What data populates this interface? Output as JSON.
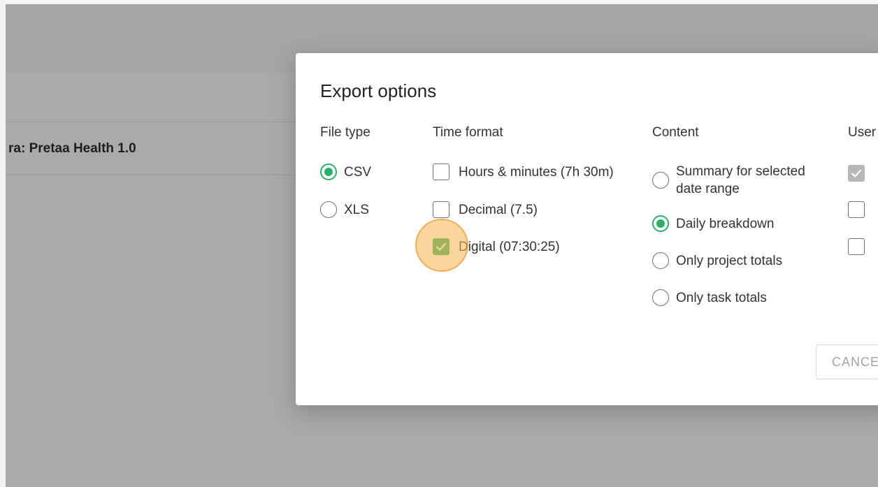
{
  "background": {
    "project_title": "ra: Pretaa Health 1.0"
  },
  "dialog": {
    "title": "Export options",
    "file_type": {
      "heading": "File type",
      "options": [
        {
          "label": "CSV",
          "selected": true
        },
        {
          "label": "XLS",
          "selected": false
        }
      ]
    },
    "time_format": {
      "heading": "Time format",
      "options": [
        {
          "label": "Hours & minutes (7h 30m)",
          "checked": false
        },
        {
          "label": "Decimal (7.5)",
          "checked": false
        },
        {
          "label": "Digital (07:30:25)",
          "checked": true
        }
      ]
    },
    "content": {
      "heading": "Content",
      "options": [
        {
          "label_line1": "Summary for selected",
          "label_line2": "date range",
          "selected": false
        },
        {
          "label": "Daily breakdown",
          "selected": true
        },
        {
          "label": "Only project totals",
          "selected": false
        },
        {
          "label": "Only task totals",
          "selected": false
        }
      ]
    },
    "user": {
      "heading": "User",
      "options": [
        {
          "checked": true
        },
        {
          "checked": false
        },
        {
          "checked": false
        }
      ]
    },
    "cancel_label": "CANCEL"
  },
  "colors": {
    "accent": "#2ab06a",
    "overlay": "#aaaaab",
    "click_highlight": "#f6b656"
  },
  "icons": {
    "check": "check-icon"
  }
}
